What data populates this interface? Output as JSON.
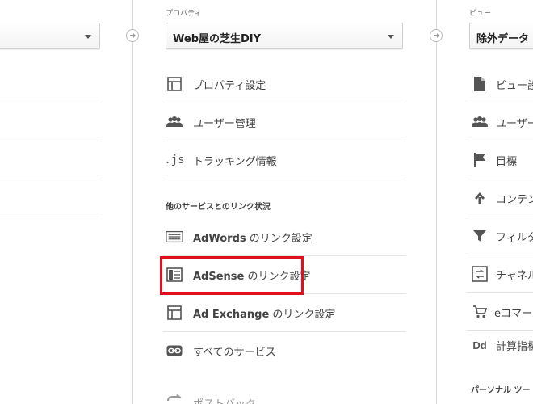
{
  "account_column": {
    "selected": ""
  },
  "property_column": {
    "label": "プロパティ",
    "selected": "Web屋の芝生DIY",
    "items": [
      {
        "label": "プロパティ設定",
        "icon": "layout-icon"
      },
      {
        "label": "ユーザー管理",
        "icon": "users-icon"
      },
      {
        "label": "トラッキング情報",
        "icon": "js-icon"
      }
    ],
    "section_title": "他のサービスとのリンク状況",
    "link_items": [
      {
        "brand": "AdWords",
        "suffix": "のリンク設定",
        "icon": "adwords-icon"
      },
      {
        "brand": "AdSense",
        "suffix": "のリンク設定",
        "icon": "adsense-icon"
      },
      {
        "brand": "Ad Exchange",
        "suffix": "のリンク設定",
        "icon": "ad-exchange-icon"
      },
      {
        "brand": "",
        "suffix": "すべてのサービス",
        "icon": "link-icon"
      }
    ],
    "partial_item": {
      "label": "ポストバック",
      "icon": "postback-icon"
    },
    "js_icon_text": ".js"
  },
  "view_column": {
    "label": "ビュー",
    "selected": "除外データ",
    "items": [
      {
        "label": "ビュー設",
        "icon": "document-icon"
      },
      {
        "label": "ユーザー",
        "icon": "users-icon"
      },
      {
        "label": "目標",
        "icon": "flag-icon"
      },
      {
        "label": "コンテン",
        "icon": "content-grouping-icon"
      },
      {
        "label": "フィルタ",
        "icon": "filter-icon"
      },
      {
        "label": "チャネル",
        "icon": "channel-icon"
      },
      {
        "label": "eコマース",
        "icon": "cart-icon"
      },
      {
        "label": "計算指標",
        "icon": "dd-icon"
      }
    ],
    "dd_icon_text": "Dd",
    "section_title": "パーソナル ツー"
  },
  "colors": {
    "highlight": "#e0101d",
    "icon": "#555555",
    "divider": "#e4e4e4"
  }
}
